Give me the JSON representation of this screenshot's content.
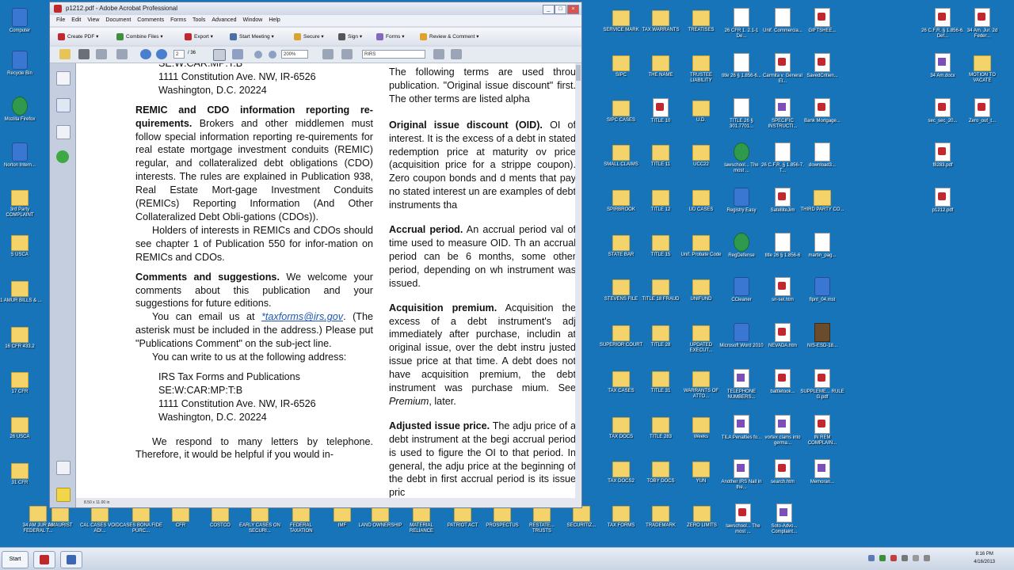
{
  "window": {
    "title": "p1212.pdf - Adobe Acrobat Professional",
    "controls": {
      "minimize": "_",
      "maximize": "□",
      "close": "×"
    },
    "menu": [
      "File",
      "Edit",
      "View",
      "Document",
      "Comments",
      "Forms",
      "Tools",
      "Advanced",
      "Window",
      "Help"
    ],
    "toolbar": {
      "create_pdf": "Create PDF",
      "combine_files": "Combine Files",
      "export": "Export",
      "start_meeting": "Start Meeting",
      "secure": "Secure",
      "sign": "Sign",
      "forms": "Forms",
      "review_comment": "Review & Comment"
    },
    "nav": {
      "page_current": "2",
      "page_total": "/ 36",
      "zoom": "200%",
      "find": "RIRS"
    },
    "status_size": "8.50 x 11.00 in"
  },
  "document": {
    "left": {
      "addr1_line1": "SE:W:CAR:MP:T:B",
      "addr1_line2": "1111 Constitution Ave. NW, IR-6526",
      "addr1_line3": "Washington, D.C. 20224",
      "remic_head": "REMIC and CDO information reporting re-quirements.",
      "remic_body": "Brokers and other middlemen must follow special information reporting re-quirements for real estate mortgage investment conduits (REMIC) regular, and collateralized debt obligations (CDO) interests. The rules are explained in Publication 938, Real Estate Mort-gage Investment Conduits (REMICs) Reporting Information (And Other Collateralized Debt Obli-gations (CDOs)).",
      "holders": "Holders of interests in REMICs and CDOs should see chapter 1 of Publication 550 for infor-mation on REMICs and CDOs.",
      "comments_head": "Comments and suggestions.",
      "comments_body": "We welcome your comments about this publication and your suggestions for future editions.",
      "email_pre": "You can email us at ",
      "email_link": "*taxforms@irs.gov",
      "email_post": ". (The asterisk must be included in the address.) Please put \"Publications Comment\" on the sub-ject line.",
      "write": "You can write to us at the following address:",
      "addr2_line1": "IRS Tax Forms and Publications",
      "addr2_line2": "SE:W:CAR:MP:T:B",
      "addr2_line3": "1111 Constitution Ave. NW, IR-6526",
      "addr2_line4": "Washington, D.C. 20224",
      "respond": "We respond to many letters by telephone. Therefore, it would be helpful if you would in-"
    },
    "right": {
      "intro": "The following terms are used throu publication. \"Original issue discount\" first. The other terms are listed alpha",
      "oid_head": "Original issue discount (OID).",
      "oid_body": "OI of interest. It is the excess of a debt in stated redemption price at maturity ov price (acquisition price for a strippe coupon). Zero coupon bonds and d ments that pay no stated interest un are examples of debt instruments tha",
      "accrual_head": "Accrual period.",
      "accrual_body": "An accrual period val of time used to measure OID. Th an accrual period can be 6 months, some other period, depending on wh instrument was issued.",
      "acq_head": "Acquisition premium.",
      "acq_body": "Acquisition the excess of a debt instrument's adj immediately after purchase, includin at original issue, over the debt instru justed issue price at that time. A debt does not have acquisition premium, the debt instrument was purchase mium. See",
      "acq_premium": "Premium",
      "acq_later": ", later.",
      "adj_head": "Adjusted issue price.",
      "adj_body": "The adju price of a debt instrument at the begi accrual period is used to figure the OI to that period. In general, the adju price at the beginning of the debt in first accrual period is its issue pric"
    }
  },
  "desktop_icons": [
    {
      "label": "Computer",
      "type": "app"
    },
    {
      "label": "Recycle Bin",
      "type": "app"
    },
    {
      "label": "Mozilla Firefox",
      "type": "web"
    },
    {
      "label": "Norton Intern...",
      "type": "app"
    },
    {
      "label": "3rd Party COMPLAINT",
      "type": "folder"
    },
    {
      "label": "5 USCA",
      "type": "folder"
    },
    {
      "label": "11 AMUR BILLS & ...",
      "type": "folder"
    },
    {
      "label": "16 CFR 433.2",
      "type": "folder"
    },
    {
      "label": "17 CFR",
      "type": "folder"
    },
    {
      "label": "26 USCA",
      "type": "folder"
    },
    {
      "label": "31 CFR",
      "type": "folder"
    },
    {
      "label": "34 AM JUR 2d FEDERAL T...",
      "type": "folder"
    },
    {
      "label": "AMAURIST",
      "type": "folder"
    },
    {
      "label": "CAL CASES VOID ADI...",
      "type": "folder"
    },
    {
      "label": "CASES BONA FIDE PURC...",
      "type": "folder"
    },
    {
      "label": "CFR",
      "type": "folder"
    },
    {
      "label": "COSTCO",
      "type": "folder"
    },
    {
      "label": "EARLY CASES ON SECURI...",
      "type": "folder"
    },
    {
      "label": "FEDERAL TAXATION",
      "type": "folder"
    },
    {
      "label": "IMF",
      "type": "folder"
    },
    {
      "label": "LAND OWNERSHIP",
      "type": "folder"
    },
    {
      "label": "MATERIAL RELIANCE",
      "type": "folder"
    },
    {
      "label": "PATRIOT ACT",
      "type": "folder"
    },
    {
      "label": "PROSPECTUS",
      "type": "folder"
    },
    {
      "label": "RESTATE... TRUSTS",
      "type": "folder"
    },
    {
      "label": "SECURITIZ...",
      "type": "folder"
    },
    {
      "label": "TAX FORMS",
      "type": "folder"
    },
    {
      "label": "TRADEMARK",
      "type": "folder"
    },
    {
      "label": "ZERO LIMITS",
      "type": "folder"
    },
    {
      "label": "lawschool... The most ...",
      "type": "pdf"
    },
    {
      "label": "Soto-Advo... Complaint...",
      "type": "xls"
    },
    {
      "label": "SERVICE MARK",
      "type": "folder"
    },
    {
      "label": "SIPC",
      "type": "folder"
    },
    {
      "label": "SIPC CASES",
      "type": "folder"
    },
    {
      "label": "SMALL CLAIMS",
      "type": "folder"
    },
    {
      "label": "SPIRBROOK",
      "type": "folder"
    },
    {
      "label": "STATE BAR",
      "type": "folder"
    },
    {
      "label": "STEVENS FILE",
      "type": "folder"
    },
    {
      "label": "SUPERIOR COURT",
      "type": "folder"
    },
    {
      "label": "TAX CASES",
      "type": "folder"
    },
    {
      "label": "TAX DOCS",
      "type": "folder"
    },
    {
      "label": "TAX DOCS2",
      "type": "folder"
    },
    {
      "label": "TAX WARRANTS",
      "type": "folder"
    },
    {
      "label": "THE NAME",
      "type": "folder"
    },
    {
      "label": "TITLE 10",
      "type": "pdf"
    },
    {
      "label": "TITLE 11",
      "type": "folder"
    },
    {
      "label": "TITLE 12",
      "type": "folder"
    },
    {
      "label": "TITLE 15",
      "type": "folder"
    },
    {
      "label": "TITLE 18 FRAUD",
      "type": "folder"
    },
    {
      "label": "TITLE 28",
      "type": "folder"
    },
    {
      "label": "TITLE 31",
      "type": "folder"
    },
    {
      "label": "TITLE 283",
      "type": "folder"
    },
    {
      "label": "TOBY DOCS",
      "type": "folder"
    },
    {
      "label": "TREATISES",
      "type": "folder"
    },
    {
      "label": "TRUSTEE LIABILITY",
      "type": "folder"
    },
    {
      "label": "U.D.",
      "type": "folder"
    },
    {
      "label": "UCC22",
      "type": "folder"
    },
    {
      "label": "UD CASES",
      "type": "folder"
    },
    {
      "label": "Unif. Probate Code",
      "type": "folder"
    },
    {
      "label": "UNIFUND",
      "type": "folder"
    },
    {
      "label": "UPDATED EXECUT...",
      "type": "folder"
    },
    {
      "label": "WARRANTS OF ATTO...",
      "type": "folder"
    },
    {
      "label": "Weeks",
      "type": "folder"
    },
    {
      "label": "YUN",
      "type": "folder"
    },
    {
      "label": "26 CFR 1. 2.1-1 De...",
      "type": "doc"
    },
    {
      "label": "title 26 § 1.856-6...",
      "type": "doc"
    },
    {
      "label": "TITLE 26 § 301.7701...",
      "type": "doc"
    },
    {
      "label": "lawschool... The most ...",
      "type": "web"
    },
    {
      "label": "Registry Easy",
      "type": "app"
    },
    {
      "label": "RegDefense",
      "type": "web"
    },
    {
      "label": "CCleaner",
      "type": "app"
    },
    {
      "label": "Microsoft Word 2010",
      "type": "app"
    },
    {
      "label": "TELEPHONE NUMBERS...",
      "type": "xls"
    },
    {
      "label": "TILA Penalties fo...",
      "type": "xls"
    },
    {
      "label": "Another IRS Nail in the...",
      "type": "xls"
    },
    {
      "label": "Unif. Commercia...",
      "type": "doc"
    },
    {
      "label": "Carmita v. General El...",
      "type": "pdf"
    },
    {
      "label": "SPECIFIC INSTRUCTI...",
      "type": "xls"
    },
    {
      "label": "26 C.F.R. § 1.856-7. T...",
      "type": "doc"
    },
    {
      "label": "SatelliteJim",
      "type": "pdf"
    },
    {
      "label": "title 26 § 1.856-6",
      "type": "doc"
    },
    {
      "label": "sn-sel.htm",
      "type": "pdf"
    },
    {
      "label": "NEVADA.htm",
      "type": "pdf"
    },
    {
      "label": "battletook...",
      "type": "pdf"
    },
    {
      "label": "vortex clams into germa...",
      "type": "xls"
    },
    {
      "label": "search.htm",
      "type": "pdf"
    },
    {
      "label": "GIFTSHEE...",
      "type": "pdf"
    },
    {
      "label": "SavedCritien...",
      "type": "pdf"
    },
    {
      "label": "Bank Mortgage...",
      "type": "pdf"
    },
    {
      "label": "download3...",
      "type": "doc"
    },
    {
      "label": "THIRD PARTY CO...",
      "type": "folder"
    },
    {
      "label": "martin_pag...",
      "type": "doc"
    },
    {
      "label": "flpnt_04.mst",
      "type": "app"
    },
    {
      "label": "NIS-ESD-18...",
      "type": "mov"
    },
    {
      "label": "SUPPLEME... RULE G.pdf",
      "type": "pdf"
    },
    {
      "label": "IN REM COMPLAIN...",
      "type": "pdf"
    },
    {
      "label": "Memoran...",
      "type": "xls"
    },
    {
      "label": "26 C.F.R. § 1.856-6. Def...",
      "type": "pdf"
    },
    {
      "label": "34 Am. Jur. 2d Feder...",
      "type": "pdf"
    },
    {
      "label": "34 Am.docx",
      "type": "xls"
    },
    {
      "label": "MOTION TO VACATE",
      "type": "folder"
    },
    {
      "label": "sec_sec_20...",
      "type": "pdf"
    },
    {
      "label": "Zero_out_t...",
      "type": "pdf"
    },
    {
      "label": "f8283.pdf",
      "type": "pdf"
    },
    {
      "label": "p1212.pdf",
      "type": "pdf"
    }
  ],
  "taskbar": {
    "start_label": "Start",
    "time": "8:16 PM",
    "date": "4/16/2013"
  }
}
